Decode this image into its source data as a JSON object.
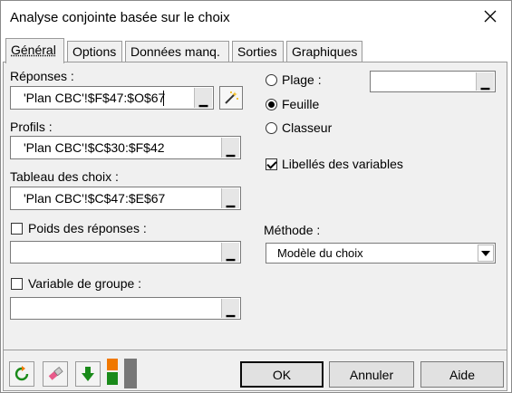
{
  "window": {
    "title": "Analyse conjointe basée sur le choix"
  },
  "tabs": [
    "Général",
    "Options",
    "Données manq.",
    "Sorties",
    "Graphiques"
  ],
  "left": {
    "responses_label": "Réponses :",
    "responses_value": "'Plan CBC'!$F$47:$O$67",
    "profiles_label": "Profils :",
    "profiles_value": "'Plan CBC'!$C$30:$F$42",
    "choices_label": "Tableau des choix :",
    "choices_value": "'Plan CBC'!$C$47:$E$67",
    "weights_label": "Poids des réponses :",
    "weights_value": "",
    "group_label": "Variable de groupe :",
    "group_value": ""
  },
  "right": {
    "range_label": "Plage :",
    "range_value": "",
    "sheet_label": "Feuille",
    "workbook_label": "Classeur",
    "varlabels_label": "Libellés des variables",
    "method_label": "Méthode :",
    "method_value": "Modèle du choix"
  },
  "buttons": {
    "ok": "OK",
    "cancel": "Annuler",
    "help": "Aide"
  },
  "colors": {
    "panel": "#f0f0f0",
    "green": "#1a8a1a",
    "orange": "#f07800"
  }
}
